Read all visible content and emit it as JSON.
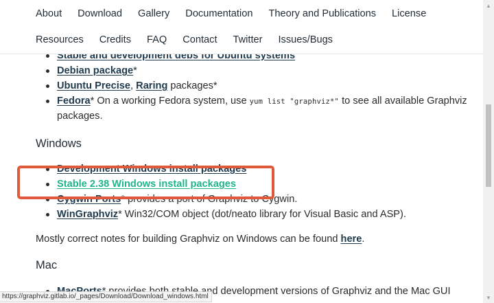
{
  "nav": {
    "row1": [
      "About",
      "Download",
      "Gallery",
      "Documentation",
      "Theory and Publications",
      "License"
    ],
    "row2": [
      "Resources",
      "Credits",
      "FAQ",
      "Contact",
      "Twitter",
      "Issues/Bugs"
    ]
  },
  "linux": {
    "item1_link": "Stable and development debs for Ubuntu systems",
    "item2_link": "Debian package",
    "item2_suffix": "*",
    "item3_link_a": "Ubuntu Precise",
    "item3_sep": ", ",
    "item3_link_b": "Raring",
    "item3_suffix": " packages*",
    "item4_link": "Fedora",
    "item4_text_a": "* On a working Fedora system, use ",
    "item4_code": "yum list \"graphviz*\"",
    "item4_text_b": " to see all available Graphviz",
    "item4_text_c": "packages."
  },
  "windows": {
    "heading": "Windows",
    "item1_link": "Development Windows install packages",
    "item2_link": "Stable 2.38 Windows install packages",
    "item3_link": "Cygwin Ports",
    "item3_text": "* provides a port of Graphviz to Cygwin.",
    "item4_link": "WinGraphviz",
    "item4_text": "* Win32/COM object (dot/neato library for Visual Basic and ASP).",
    "note_text": "Mostly correct notes for building Graphviz on Windows can be found ",
    "note_link": "here",
    "note_end": "."
  },
  "mac": {
    "heading": "Mac",
    "item1_link": "MacPorts",
    "item1_text": "* provides both stable and development versions of Graphviz and the Mac GUI"
  },
  "status": {
    "url": "https://graphviz.gitlab.io/_pages/Download/Download_windows.html"
  },
  "colors": {
    "highlight": "#de5a3a",
    "active_link": "#1fb58a",
    "link": "#1f3a4d"
  }
}
